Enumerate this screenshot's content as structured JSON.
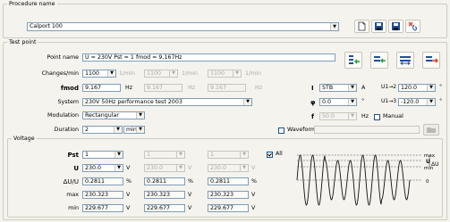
{
  "procedure": {
    "legend": "Procedure name",
    "value": "Calport 100"
  },
  "test_point": {
    "legend": "Test point",
    "point_name_label": "Point name",
    "point_name_value": "U = 230V Pst = 1 fmod = 9,167Hz",
    "changes_label": "Changes/min",
    "changes_value": "1100",
    "changes_col2": "1100",
    "changes_col3": "1100",
    "changes_unit": "1/min",
    "fmod_label": "fmod",
    "fmod_value": "9.167",
    "fmod_col2": "9.167",
    "fmod_col3": "9.167",
    "hz_unit": "Hz",
    "system_label": "System",
    "system_value": "230V 50Hz performance test 2003",
    "modulation_label": "Modulation",
    "modulation_value": "Rectangular",
    "duration_label": "Duration",
    "duration_value": "2",
    "duration_unit": "min",
    "waveform_label": "Waveform",
    "current_label": "I",
    "current_value": "STB",
    "current_unit": "A",
    "phi_label": "φ",
    "phi_value": "0.0",
    "deg_unit": "°",
    "freq_label": "f",
    "freq_value": "50.0",
    "freq_unit": "Hz",
    "manual_label": "Manual",
    "u12_label": "U1→2",
    "u12_value": "120.0",
    "u13_label": "U1→3",
    "u13_value": "-120.0"
  },
  "voltage": {
    "legend": "Voltage",
    "pst_label": "Pst",
    "pst_values": [
      "1",
      "1",
      "1"
    ],
    "u_label": "U",
    "u_values": [
      "230.0",
      "230.0",
      "230.0"
    ],
    "v_unit": "V",
    "all_label": "All",
    "du_label": "ΔU/U",
    "du_values": [
      "0.2811",
      "0.2811",
      "0.2811"
    ],
    "pct_unit": "%",
    "max_label": "max",
    "max_values": [
      "230.323",
      "230.323",
      "230.323"
    ],
    "min_label": "min",
    "min_values": [
      "229.677",
      "229.677",
      "229.677"
    ]
  },
  "waveform_legend": {
    "max": "max",
    "u": "U",
    "min": "min",
    "delta_u": "ΔU",
    "zero": "0"
  },
  "colors": {
    "icon_blue": "#1f4f9c",
    "icon_green": "#2a9d3a",
    "icon_red": "#d63b2b",
    "border_blue": "#7f9db9"
  }
}
